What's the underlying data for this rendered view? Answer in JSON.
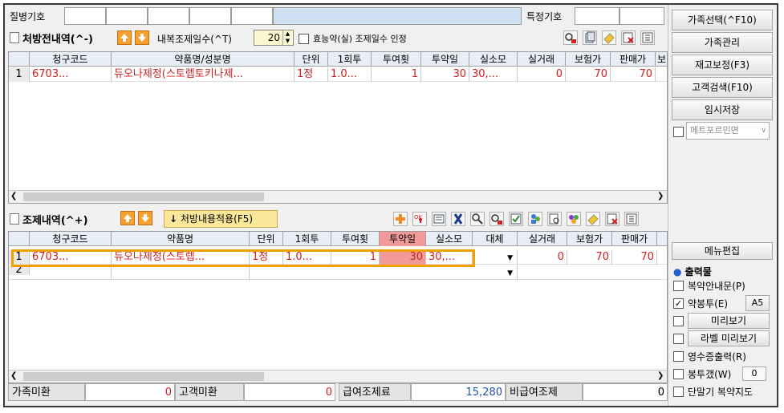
{
  "header": {
    "disease_code_label": "질병기호",
    "special_code_label": "특정기호"
  },
  "prescription": {
    "title": "처방전내역(^-)",
    "internal_days_label": "내복조제일수(^T)",
    "internal_days_value": "20",
    "equiv_label": "효능약(실) 조제일수 인정",
    "columns": [
      "",
      "청구코드",
      "약품명/성분명",
      "단위",
      "1회투",
      "투여횟",
      "투약일",
      "실소모",
      "실거래",
      "보험가",
      "판매가",
      "보"
    ],
    "rows": [
      {
        "no": "1",
        "code": "6703...",
        "name": "듀오나제정(스토렙토키나제...",
        "unit": "1정",
        "dose": "1.0...",
        "freq": "1",
        "days": "30",
        "usage": "30,...",
        "real": "0",
        "ins": "70",
        "sale": "70"
      }
    ]
  },
  "dispense": {
    "title": "조제내역(^+)",
    "apply_button": "처방내용적용(F5)",
    "columns": [
      "",
      "청구코드",
      "약품명",
      "단위",
      "1회투",
      "투여횟",
      "투약일",
      "실소모",
      "대체",
      "실거래",
      "보험가",
      "판매가"
    ],
    "rows": [
      {
        "no": "1",
        "code": "6703...",
        "name": "듀오나제정(스토렙...",
        "unit": "1정",
        "dose": "1.0...",
        "freq": "1",
        "days": "30",
        "usage": "30,...",
        "sub": "",
        "real": "0",
        "ins": "70",
        "sale": "70"
      },
      {
        "no": "2",
        "code": "",
        "name": "",
        "unit": "",
        "dose": "",
        "freq": "",
        "days": "",
        "usage": "",
        "sub": "",
        "real": "",
        "ins": "",
        "sale": ""
      }
    ]
  },
  "sidebar": {
    "buttons": [
      "가족선택(^F10)",
      "가족관리",
      "재고보정(F3)",
      "고객검색(F10)",
      "임시저장"
    ],
    "combo_placeholder": "메트포르민면",
    "menu_edit": "메뉴편집",
    "output_title": "출력물",
    "options": [
      {
        "label": "복약안내문(P)",
        "checked": false
      },
      {
        "label": "약봉투(E)",
        "checked": true,
        "extra": "A5"
      },
      {
        "label": "미리보기",
        "checked": false
      },
      {
        "label": "라벨 미리보기",
        "checked": false
      },
      {
        "label": "영수증출력(R)",
        "checked": false
      },
      {
        "label": "봉투갰(W)",
        "checked": false,
        "extra": "0"
      },
      {
        "label": "단말기 복약지도",
        "checked": false
      }
    ]
  },
  "footer": {
    "family_unpaid_label": "가족미환",
    "family_unpaid_value": "0",
    "customer_unpaid_label": "고객미환",
    "customer_unpaid_value": "0",
    "fee_label": "급여조제료",
    "fee_value": "15,280",
    "nonfee_label": "비급여조제",
    "nonfee_value": "0"
  },
  "colors": {
    "accent_red": "#d02020",
    "highlight_border": "#f0a000",
    "days_highlight": "#f29a9a"
  }
}
